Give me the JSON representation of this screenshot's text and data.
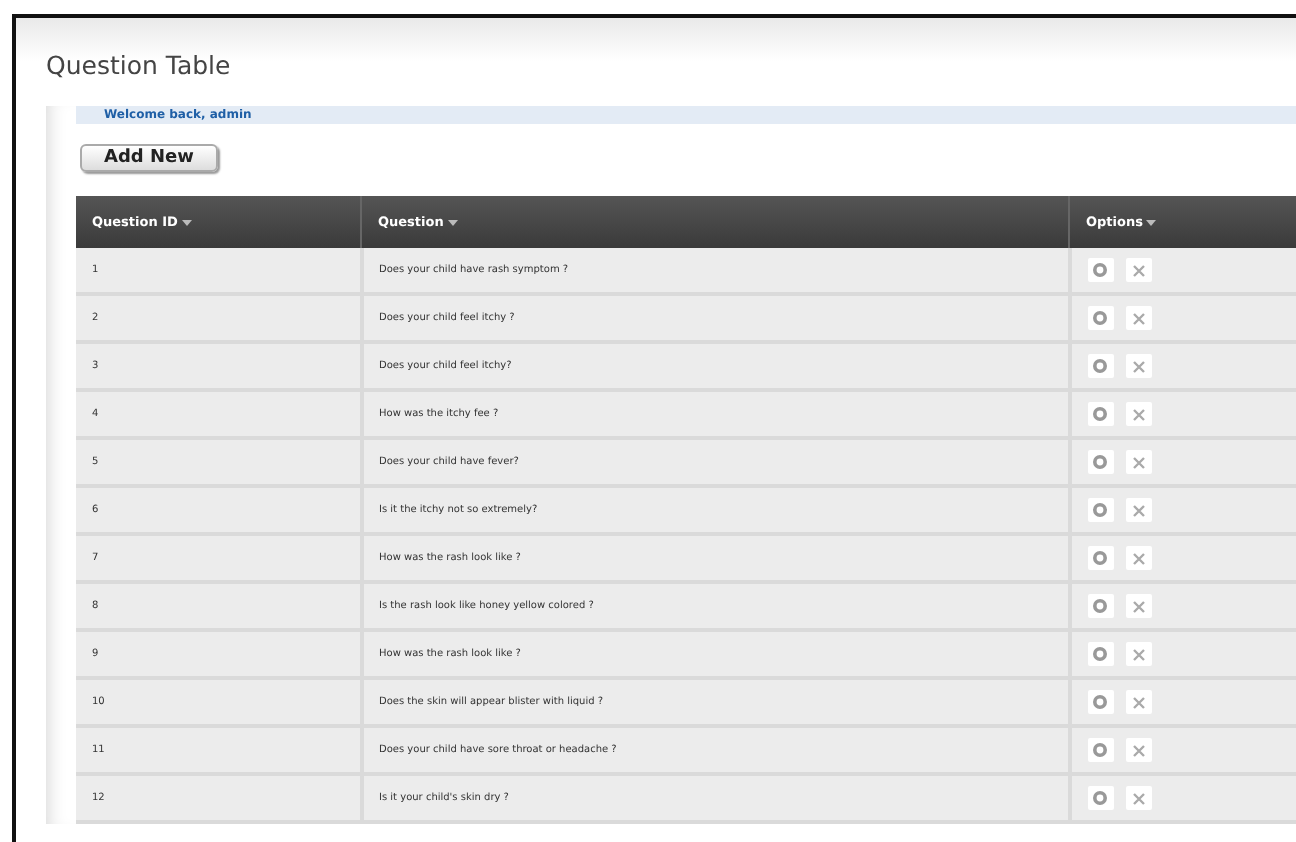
{
  "page": {
    "title": "Question Table",
    "welcome": "Welcome back, admin",
    "add_button": "Add New"
  },
  "table": {
    "columns": [
      "Question ID",
      "Question",
      "Options"
    ],
    "rows": [
      {
        "id": "1",
        "question": "Does your child have rash symptom ?"
      },
      {
        "id": "2",
        "question": "Does your child feel itchy ?"
      },
      {
        "id": "3",
        "question": "Does your child feel itchy?"
      },
      {
        "id": "4",
        "question": "How was the itchy fee ?"
      },
      {
        "id": "5",
        "question": "Does your child have fever?"
      },
      {
        "id": "6",
        "question": "Is it the itchy not so extremely?"
      },
      {
        "id": "7",
        "question": "How was the rash look like ?"
      },
      {
        "id": "8",
        "question": "Is the rash look like honey yellow colored ?"
      },
      {
        "id": "9",
        "question": "How was the rash look like ?"
      },
      {
        "id": "10",
        "question": "Does the skin will appear blister with liquid ?"
      },
      {
        "id": "11",
        "question": "Does your child have sore throat or headache ?"
      },
      {
        "id": "12",
        "question": "Is it your child's skin dry ?"
      }
    ]
  }
}
